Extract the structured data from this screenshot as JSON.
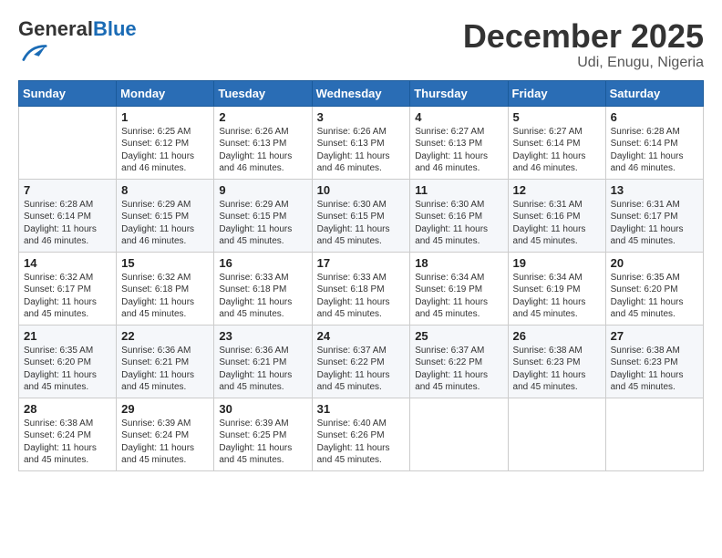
{
  "header": {
    "logo_general": "General",
    "logo_blue": "Blue",
    "month_title": "December 2025",
    "location": "Udi, Enugu, Nigeria"
  },
  "weekdays": [
    "Sunday",
    "Monday",
    "Tuesday",
    "Wednesday",
    "Thursday",
    "Friday",
    "Saturday"
  ],
  "weeks": [
    [
      null,
      {
        "day": "1",
        "sunrise": "6:25 AM",
        "sunset": "6:12 PM",
        "daylight": "11 hours and 46 minutes."
      },
      {
        "day": "2",
        "sunrise": "6:26 AM",
        "sunset": "6:13 PM",
        "daylight": "11 hours and 46 minutes."
      },
      {
        "day": "3",
        "sunrise": "6:26 AM",
        "sunset": "6:13 PM",
        "daylight": "11 hours and 46 minutes."
      },
      {
        "day": "4",
        "sunrise": "6:27 AM",
        "sunset": "6:13 PM",
        "daylight": "11 hours and 46 minutes."
      },
      {
        "day": "5",
        "sunrise": "6:27 AM",
        "sunset": "6:14 PM",
        "daylight": "11 hours and 46 minutes."
      },
      {
        "day": "6",
        "sunrise": "6:28 AM",
        "sunset": "6:14 PM",
        "daylight": "11 hours and 46 minutes."
      }
    ],
    [
      {
        "day": "7",
        "sunrise": "6:28 AM",
        "sunset": "6:14 PM",
        "daylight": "11 hours and 46 minutes."
      },
      {
        "day": "8",
        "sunrise": "6:29 AM",
        "sunset": "6:15 PM",
        "daylight": "11 hours and 46 minutes."
      },
      {
        "day": "9",
        "sunrise": "6:29 AM",
        "sunset": "6:15 PM",
        "daylight": "11 hours and 45 minutes."
      },
      {
        "day": "10",
        "sunrise": "6:30 AM",
        "sunset": "6:15 PM",
        "daylight": "11 hours and 45 minutes."
      },
      {
        "day": "11",
        "sunrise": "6:30 AM",
        "sunset": "6:16 PM",
        "daylight": "11 hours and 45 minutes."
      },
      {
        "day": "12",
        "sunrise": "6:31 AM",
        "sunset": "6:16 PM",
        "daylight": "11 hours and 45 minutes."
      },
      {
        "day": "13",
        "sunrise": "6:31 AM",
        "sunset": "6:17 PM",
        "daylight": "11 hours and 45 minutes."
      }
    ],
    [
      {
        "day": "14",
        "sunrise": "6:32 AM",
        "sunset": "6:17 PM",
        "daylight": "11 hours and 45 minutes."
      },
      {
        "day": "15",
        "sunrise": "6:32 AM",
        "sunset": "6:18 PM",
        "daylight": "11 hours and 45 minutes."
      },
      {
        "day": "16",
        "sunrise": "6:33 AM",
        "sunset": "6:18 PM",
        "daylight": "11 hours and 45 minutes."
      },
      {
        "day": "17",
        "sunrise": "6:33 AM",
        "sunset": "6:18 PM",
        "daylight": "11 hours and 45 minutes."
      },
      {
        "day": "18",
        "sunrise": "6:34 AM",
        "sunset": "6:19 PM",
        "daylight": "11 hours and 45 minutes."
      },
      {
        "day": "19",
        "sunrise": "6:34 AM",
        "sunset": "6:19 PM",
        "daylight": "11 hours and 45 minutes."
      },
      {
        "day": "20",
        "sunrise": "6:35 AM",
        "sunset": "6:20 PM",
        "daylight": "11 hours and 45 minutes."
      }
    ],
    [
      {
        "day": "21",
        "sunrise": "6:35 AM",
        "sunset": "6:20 PM",
        "daylight": "11 hours and 45 minutes."
      },
      {
        "day": "22",
        "sunrise": "6:36 AM",
        "sunset": "6:21 PM",
        "daylight": "11 hours and 45 minutes."
      },
      {
        "day": "23",
        "sunrise": "6:36 AM",
        "sunset": "6:21 PM",
        "daylight": "11 hours and 45 minutes."
      },
      {
        "day": "24",
        "sunrise": "6:37 AM",
        "sunset": "6:22 PM",
        "daylight": "11 hours and 45 minutes."
      },
      {
        "day": "25",
        "sunrise": "6:37 AM",
        "sunset": "6:22 PM",
        "daylight": "11 hours and 45 minutes."
      },
      {
        "day": "26",
        "sunrise": "6:38 AM",
        "sunset": "6:23 PM",
        "daylight": "11 hours and 45 minutes."
      },
      {
        "day": "27",
        "sunrise": "6:38 AM",
        "sunset": "6:23 PM",
        "daylight": "11 hours and 45 minutes."
      }
    ],
    [
      {
        "day": "28",
        "sunrise": "6:38 AM",
        "sunset": "6:24 PM",
        "daylight": "11 hours and 45 minutes."
      },
      {
        "day": "29",
        "sunrise": "6:39 AM",
        "sunset": "6:24 PM",
        "daylight": "11 hours and 45 minutes."
      },
      {
        "day": "30",
        "sunrise": "6:39 AM",
        "sunset": "6:25 PM",
        "daylight": "11 hours and 45 minutes."
      },
      {
        "day": "31",
        "sunrise": "6:40 AM",
        "sunset": "6:26 PM",
        "daylight": "11 hours and 45 minutes."
      },
      null,
      null,
      null
    ]
  ]
}
